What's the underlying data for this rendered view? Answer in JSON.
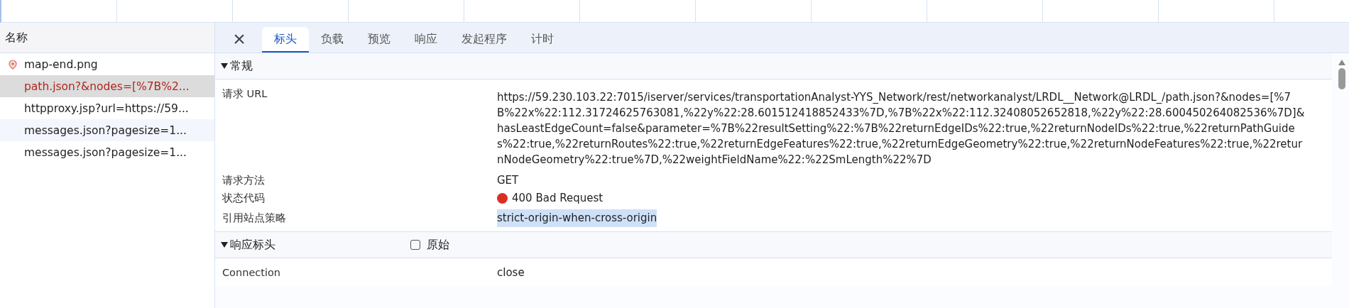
{
  "requests": {
    "header": "名称",
    "items": [
      {
        "name": "map-end.png",
        "kind": "image",
        "selected": false,
        "failed": false
      },
      {
        "name": "path.json?&nodes=[%7B%2...",
        "kind": "fetch",
        "selected": true,
        "failed": true
      },
      {
        "name": "httpproxy.jsp?url=https://59...",
        "kind": "fetch",
        "selected": false,
        "failed": false
      },
      {
        "name": "messages.json?pagesize=1...",
        "kind": "fetch",
        "selected": false,
        "failed": false
      },
      {
        "name": "messages.json?pagesize=1...",
        "kind": "fetch",
        "selected": false,
        "failed": false
      }
    ]
  },
  "close_button": "×",
  "tabs": [
    {
      "label": "标头",
      "selected": true
    },
    {
      "label": "负载",
      "selected": false
    },
    {
      "label": "预览",
      "selected": false
    },
    {
      "label": "响应",
      "selected": false
    },
    {
      "label": "发起程序",
      "selected": false
    },
    {
      "label": "计时",
      "selected": false
    }
  ],
  "general": {
    "title": "常规",
    "expanded": true,
    "rows": [
      {
        "label": "请求 URL",
        "value": "https://59.230.103.22:7015/iserver/services/transportationAnalyst-YYS_Network/rest/networkanalyst/LRDL__Network@LRDL_/path.json?&nodes=[%7B%22x%22:112.31724625763081,%22y%22:28.601512418852433%7D,%7B%22x%22:112.32408052652818,%22y%22:28.600450264082536%7D]&hasLeastEdgeCount=false&parameter=%7B%22resultSetting%22:%7B%22returnEdgeIDs%22:true,%22returnNodeIDs%22:true,%22returnPathGuides%22:true,%22returnRoutes%22:true,%22returnEdgeFeatures%22:true,%22returnEdgeGeometry%22:true,%22returnNodeFeatures%22:true,%22returnNodeGeometry%22:true%7D,%22weightFieldName%22:%22SmLength%22%7D",
        "kind": "url"
      },
      {
        "label": "请求方法",
        "value": "GET",
        "kind": "text"
      },
      {
        "label": "状态代码",
        "value": "400 Bad Request",
        "kind": "status",
        "color": "#d93025"
      },
      {
        "label": "引用站点策略",
        "value": "strict-origin-when-cross-origin",
        "kind": "highlighted"
      }
    ]
  },
  "response_headers": {
    "title": "响应标头",
    "expanded": true,
    "raw": {
      "label": "原始",
      "checked": false
    },
    "rows": [
      {
        "label": "Connection",
        "value": "close"
      }
    ]
  }
}
